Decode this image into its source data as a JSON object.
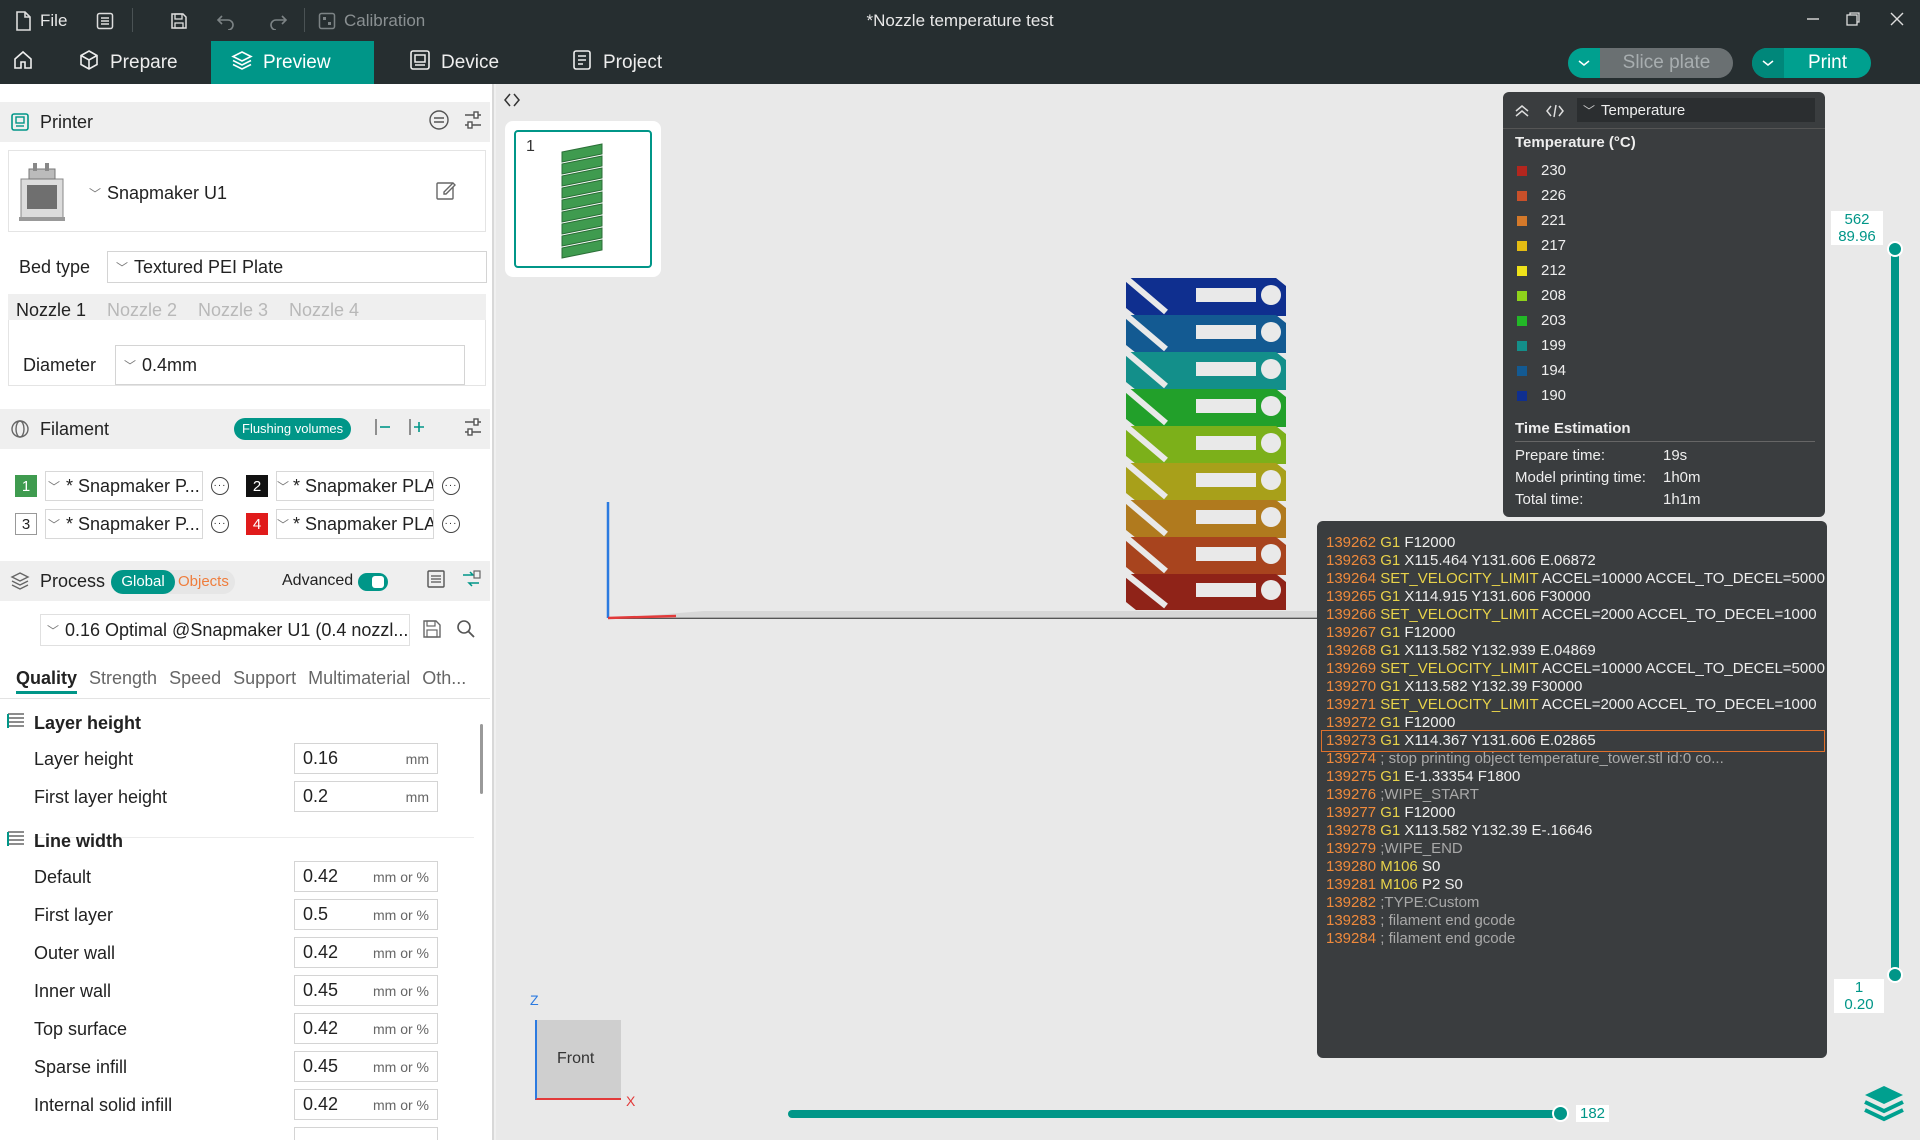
{
  "titlebar": {
    "file_label": "File",
    "calibration_label": "Calibration",
    "window_title": "*Nozzle temperature test"
  },
  "nav": {
    "tabs": [
      {
        "label": "Prepare",
        "icon": "cube-icon"
      },
      {
        "label": "Preview",
        "icon": "layers-icon"
      },
      {
        "label": "Device",
        "icon": "device-icon"
      },
      {
        "label": "Project",
        "icon": "project-icon"
      }
    ],
    "active_tab": "Preview",
    "slice_label": "Slice plate",
    "print_label": "Print",
    "accent": "#009688"
  },
  "printer": {
    "section_label": "Printer",
    "name": "Snapmaker U1",
    "bed_type_label": "Bed type",
    "bed_type": "Textured PEI Plate",
    "nozzles": [
      "Nozzle 1",
      "Nozzle 2",
      "Nozzle 3",
      "Nozzle 4"
    ],
    "diameter_label": "Diameter",
    "diameter": "0.4mm"
  },
  "filament": {
    "section_label": "Filament",
    "flushing_label": "Flushing volumes",
    "slots": [
      {
        "num": "1",
        "name": "* Snapmaker P...",
        "color": "#3f9b4f"
      },
      {
        "num": "2",
        "name": "* Snapmaker PLA...",
        "color": "#111111"
      },
      {
        "num": "3",
        "name": "* Snapmaker P...",
        "color": "#ffffff"
      },
      {
        "num": "4",
        "name": "* Snapmaker PLA...",
        "color": "#e01b1b"
      }
    ]
  },
  "process": {
    "section_label": "Process",
    "global_label": "Global",
    "objects_label": "Objects",
    "advanced_label": "Advanced",
    "preset": "0.16 Optimal @Snapmaker U1 (0.4 nozzl...",
    "tabs": [
      "Quality",
      "Strength",
      "Speed",
      "Support",
      "Multimaterial",
      "Oth..."
    ],
    "groups": [
      {
        "title": "Layer height",
        "rows": [
          {
            "label": "Layer height",
            "value": "0.16",
            "unit": "mm"
          },
          {
            "label": "First layer height",
            "value": "0.2",
            "unit": "mm"
          }
        ]
      },
      {
        "title": "Line width",
        "rows": [
          {
            "label": "Default",
            "value": "0.42",
            "unit": "mm or %"
          },
          {
            "label": "First layer",
            "value": "0.5",
            "unit": "mm or %"
          },
          {
            "label": "Outer wall",
            "value": "0.42",
            "unit": "mm or %"
          },
          {
            "label": "Inner wall",
            "value": "0.45",
            "unit": "mm or %"
          },
          {
            "label": "Top surface",
            "value": "0.42",
            "unit": "mm or %"
          },
          {
            "label": "Sparse infill",
            "value": "0.45",
            "unit": "mm or %"
          },
          {
            "label": "Internal solid infill",
            "value": "0.42",
            "unit": "mm or %"
          }
        ]
      }
    ]
  },
  "plate": {
    "number": "1"
  },
  "legend": {
    "dropdown": "Temperature",
    "title": "Temperature (°C)",
    "items": [
      {
        "value": "230",
        "color": "#b3261e"
      },
      {
        "value": "226",
        "color": "#c9502a"
      },
      {
        "value": "221",
        "color": "#d4792a"
      },
      {
        "value": "217",
        "color": "#e4bc13"
      },
      {
        "value": "212",
        "color": "#efe21a"
      },
      {
        "value": "208",
        "color": "#8fd31b"
      },
      {
        "value": "203",
        "color": "#22b827"
      },
      {
        "value": "199",
        "color": "#138f8a"
      },
      {
        "value": "194",
        "color": "#135a92"
      },
      {
        "value": "190",
        "color": "#0f2f8f"
      }
    ],
    "time_title": "Time Estimation",
    "times": [
      {
        "label": "Prepare time:",
        "value": "19s"
      },
      {
        "label": "Model printing time:",
        "value": "1h0m"
      },
      {
        "label": "Total time:",
        "value": "1h1m"
      }
    ]
  },
  "gcode": {
    "highlight_index": 11,
    "lines": [
      {
        "n": "139262",
        "cmd": "G1",
        "args": "F12000",
        "type": "cmd"
      },
      {
        "n": "139263",
        "cmd": "G1",
        "args": "X115.464 Y131.606 E.06872",
        "type": "cmd"
      },
      {
        "n": "139264",
        "cmd": "SET_VELOCITY_LIMIT",
        "args": "ACCEL=10000 ACCEL_TO_DECEL=5000",
        "type": "cmd"
      },
      {
        "n": "139265",
        "cmd": "G1",
        "args": "X114.915 Y131.606 F30000",
        "type": "cmd"
      },
      {
        "n": "139266",
        "cmd": "SET_VELOCITY_LIMIT",
        "args": "ACCEL=2000 ACCEL_TO_DECEL=1000",
        "type": "cmd"
      },
      {
        "n": "139267",
        "cmd": "G1",
        "args": "F12000",
        "type": "cmd"
      },
      {
        "n": "139268",
        "cmd": "G1",
        "args": "X113.582 Y132.939 E.04869",
        "type": "cmd"
      },
      {
        "n": "139269",
        "cmd": "SET_VELOCITY_LIMIT",
        "args": "ACCEL=10000 ACCEL_TO_DECEL=5000",
        "type": "cmd"
      },
      {
        "n": "139270",
        "cmd": "G1",
        "args": "X113.582 Y132.39 F30000",
        "type": "cmd"
      },
      {
        "n": "139271",
        "cmd": "SET_VELOCITY_LIMIT",
        "args": "ACCEL=2000 ACCEL_TO_DECEL=1000",
        "type": "cmd"
      },
      {
        "n": "139272",
        "cmd": "G1",
        "args": "F12000",
        "type": "cmd"
      },
      {
        "n": "139273",
        "cmd": "G1",
        "args": "X114.367 Y131.606 E.02865",
        "type": "cmd"
      },
      {
        "n": "139274",
        "cmd": "",
        "args": "; stop printing object temperature_tower.stl id:0 co...",
        "type": "comment"
      },
      {
        "n": "139275",
        "cmd": "G1",
        "args": "E-1.33354 F1800",
        "type": "cmd"
      },
      {
        "n": "139276",
        "cmd": "",
        "args": ";WIPE_START",
        "type": "comment"
      },
      {
        "n": "139277",
        "cmd": "G1",
        "args": "F12000",
        "type": "cmd"
      },
      {
        "n": "139278",
        "cmd": "G1",
        "args": "X113.582 Y132.39 E-.16646",
        "type": "cmd"
      },
      {
        "n": "139279",
        "cmd": "",
        "args": ";WIPE_END",
        "type": "comment"
      },
      {
        "n": "139280",
        "cmd": "M106",
        "args": "S0",
        "type": "cmd"
      },
      {
        "n": "139281",
        "cmd": "M106",
        "args": "P2 S0",
        "type": "cmd"
      },
      {
        "n": "139282",
        "cmd": "",
        "args": ";TYPE:Custom",
        "type": "comment"
      },
      {
        "n": "139283",
        "cmd": "",
        "args": "; filament end gcode",
        "type": "comment"
      },
      {
        "n": "139284",
        "cmd": "",
        "args": "; filament end gcode",
        "type": "comment"
      }
    ]
  },
  "layer_slider": {
    "top_layer": "562",
    "top_height": "89.96",
    "bottom_layer": "1",
    "bottom_height": "0.20"
  },
  "move_slider": {
    "value": "182"
  },
  "view_cube": {
    "face": "Front",
    "x_axis": "X",
    "z_axis": "Z"
  }
}
